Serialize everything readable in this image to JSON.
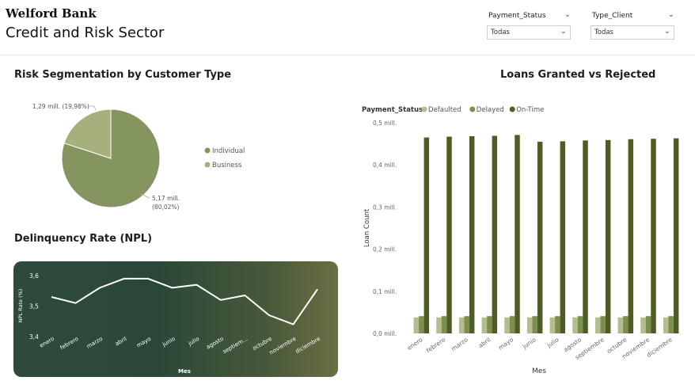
{
  "header": {
    "bank_name": "Welford Bank",
    "title": "Credit and Risk Sector"
  },
  "filters": [
    {
      "label": "Payment_Status",
      "value": "Todas"
    },
    {
      "label": "Type_Client",
      "value": "Todas"
    }
  ],
  "icons": {
    "dropdown": "chevron-down-icon"
  },
  "colors": {
    "individual": "#859560",
    "business": "#a6b07c",
    "defaulted": "#b3bd90",
    "delayed": "#7c8f4e",
    "on_time": "#4d5e24",
    "npl_line": "#ffffff"
  },
  "pie_section": {
    "title": "Risk Segmentation by Customer Type"
  },
  "loans_section": {
    "title": "Loans Granted vs Rejected"
  },
  "npl_section": {
    "title": "Delinquency Rate (NPL)"
  },
  "chart_data": [
    {
      "type": "pie",
      "labels": [
        "Individual",
        "Business"
      ],
      "values": [
        5.17,
        1.29
      ],
      "percentages": [
        80.02,
        19.98
      ],
      "data_labels": [
        "5,17 mill. (80,02%)",
        "1,29 mill. (19,98%)"
      ],
      "data_label_parts": [
        [
          "5,17 mill.",
          "(80,02%)"
        ],
        [
          "1,29 mill. (19,98%)"
        ]
      ],
      "legend": [
        "Individual",
        "Business"
      ],
      "legend_position": "right"
    },
    {
      "type": "bar",
      "legend_title": "Payment_Status",
      "legend_position": "top-left",
      "categories": [
        "enero",
        "febrero",
        "marzo",
        "abril",
        "mayo",
        "junio",
        "julio",
        "agosto",
        "septiembre",
        "octubre",
        "noviembre",
        "diciembre"
      ],
      "series": [
        {
          "name": "Defaulted",
          "values": [
            0.038,
            0.038,
            0.038,
            0.038,
            0.038,
            0.038,
            0.038,
            0.038,
            0.038,
            0.038,
            0.038,
            0.038
          ]
        },
        {
          "name": "Delayed",
          "values": [
            0.041,
            0.041,
            0.041,
            0.041,
            0.041,
            0.041,
            0.041,
            0.041,
            0.041,
            0.041,
            0.041,
            0.041
          ]
        },
        {
          "name": "On-Time",
          "values": [
            0.465,
            0.467,
            0.468,
            0.469,
            0.471,
            0.455,
            0.456,
            0.458,
            0.459,
            0.461,
            0.462,
            0.463
          ]
        }
      ],
      "xlabel": "Mes",
      "ylabel": "Loan Count",
      "ylim": [
        0,
        0.5
      ],
      "yticks": [
        "0,0 mill.",
        "0,1 mill.",
        "0,2 mill.",
        "0,3 mill.",
        "0,4 mill.",
        "0,5 mill."
      ],
      "grid": false
    },
    {
      "type": "line",
      "categories": [
        "enero",
        "febrero",
        "marzo",
        "abril",
        "mayo",
        "junio",
        "julio",
        "agosto",
        "septiem...",
        "octubre",
        "noviembre",
        "diciembre"
      ],
      "values": [
        3.53,
        3.51,
        3.56,
        3.59,
        3.59,
        3.56,
        3.57,
        3.52,
        3.535,
        3.47,
        3.44,
        3.555
      ],
      "xlabel": "Mes",
      "ylabel": "NPL Rate (%)",
      "ylim": [
        3.4,
        3.6
      ],
      "yticks": [
        "3,4",
        "3,5",
        "3,6"
      ],
      "grid": false
    }
  ]
}
